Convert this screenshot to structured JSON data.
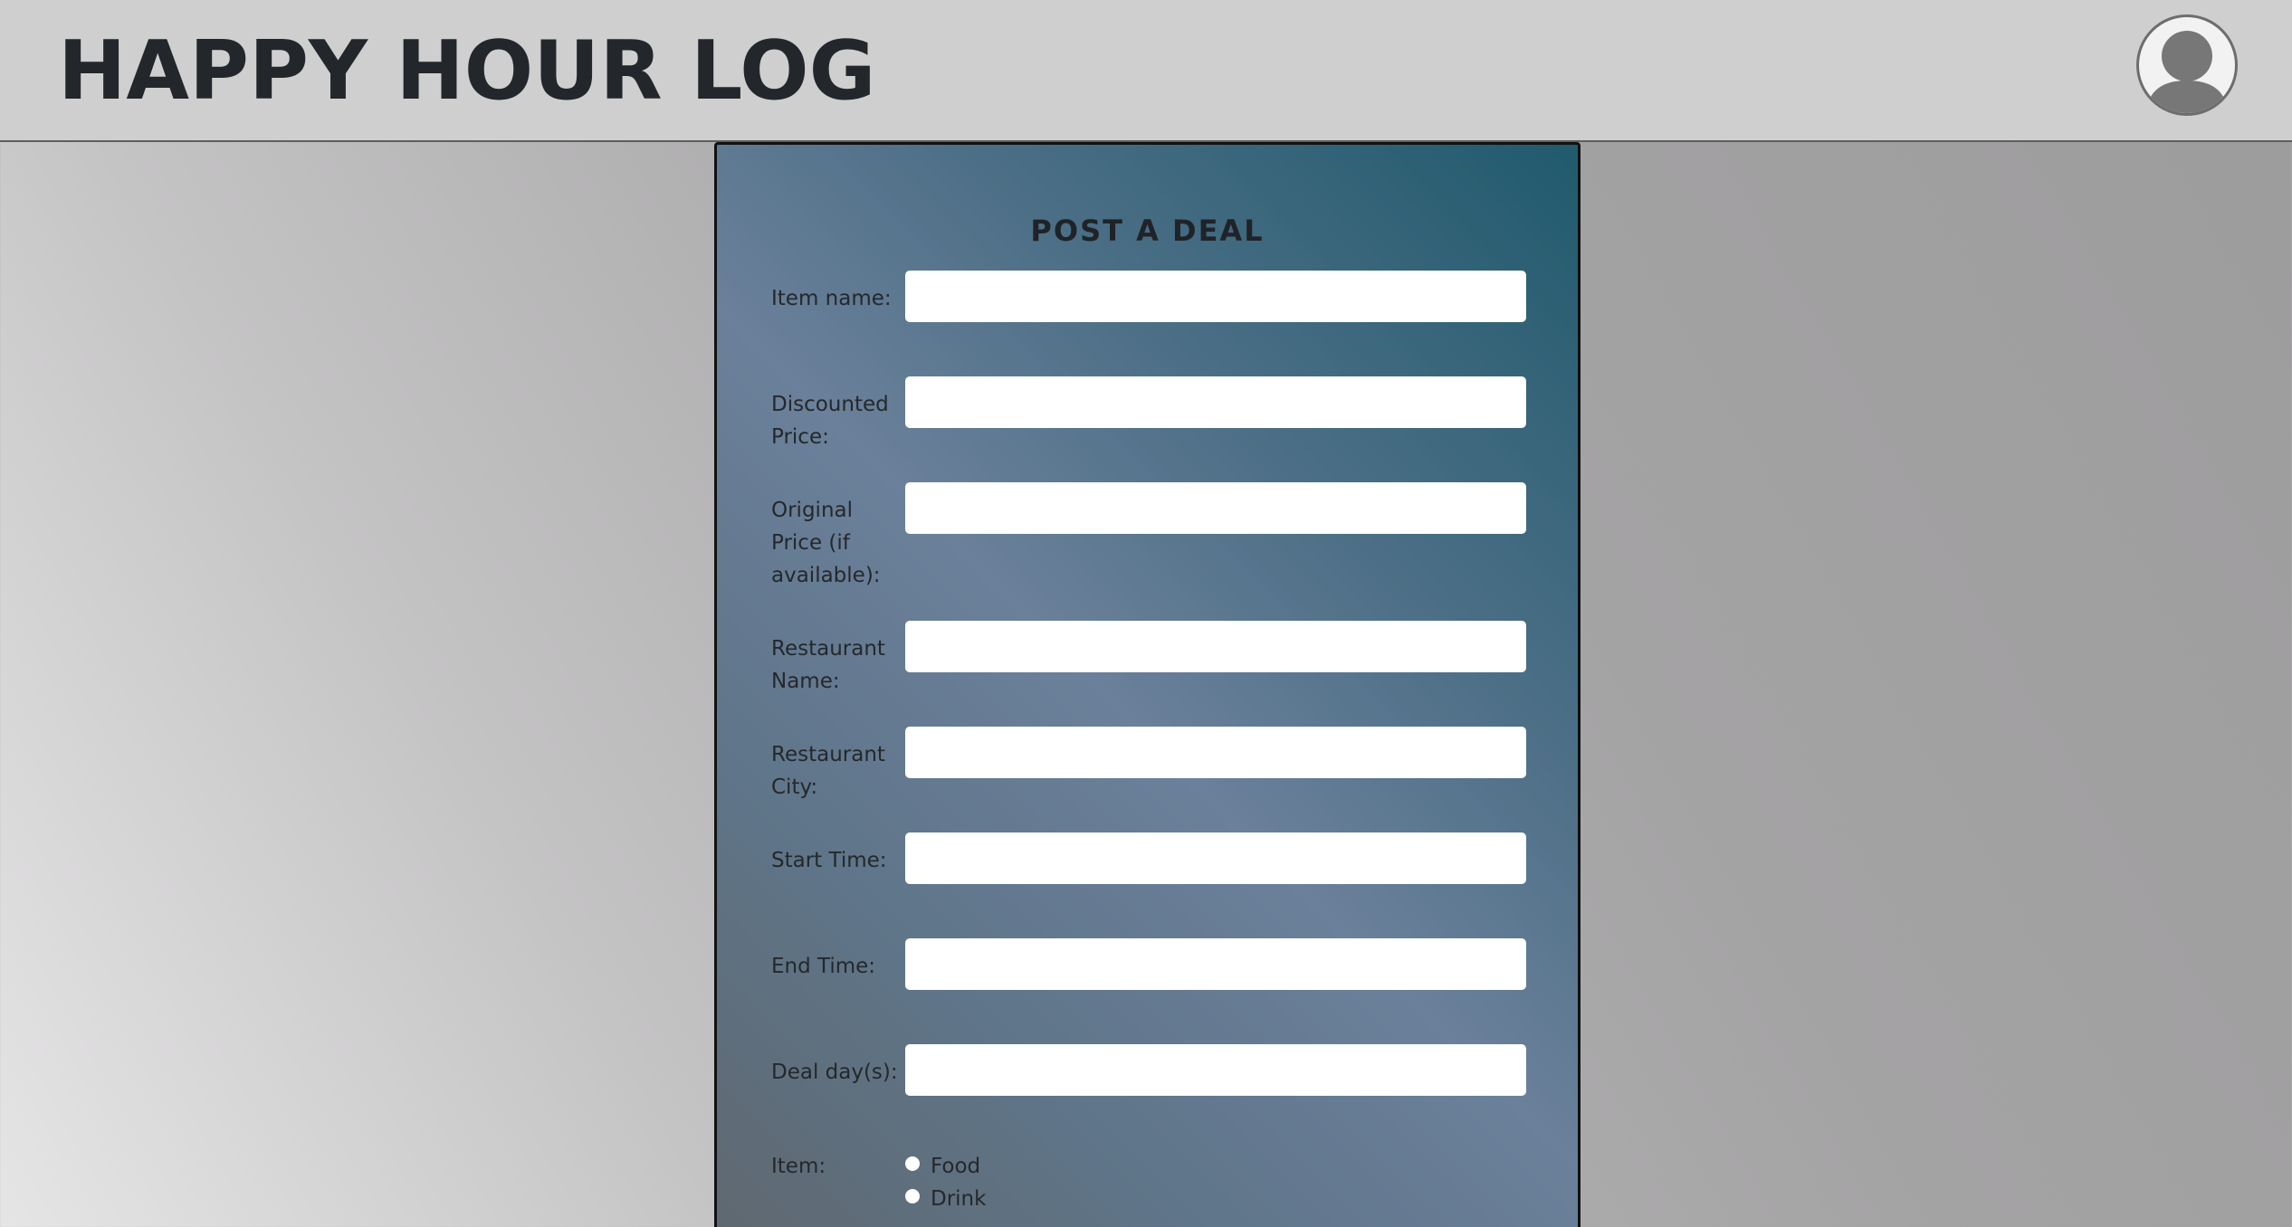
{
  "header": {
    "title": "HAPPY HOUR LOG",
    "avatar_icon": "user-avatar-icon"
  },
  "form": {
    "title": "POST A DEAL",
    "fields": [
      {
        "label": "Item name:",
        "value": "",
        "placeholder": ""
      },
      {
        "label": "Discounted Price:",
        "value": "",
        "placeholder": ""
      },
      {
        "label": "Original Price (if available):",
        "value": "",
        "placeholder": ""
      },
      {
        "label": "Restaurant Name:",
        "value": "",
        "placeholder": ""
      },
      {
        "label": "Restaurant City:",
        "value": "",
        "placeholder": ""
      },
      {
        "label": "Start Time:",
        "value": "",
        "placeholder": ""
      },
      {
        "label": "End Time:",
        "value": "",
        "placeholder": ""
      },
      {
        "label": "Deal day(s):",
        "value": "",
        "placeholder": ""
      }
    ],
    "item_type": {
      "label": "Item:",
      "options": [
        "Food",
        "Drink"
      ]
    }
  },
  "colors": {
    "header_bg": "#cfcfcf",
    "title_text": "#23272c",
    "panel_accent": "#215a6d"
  }
}
